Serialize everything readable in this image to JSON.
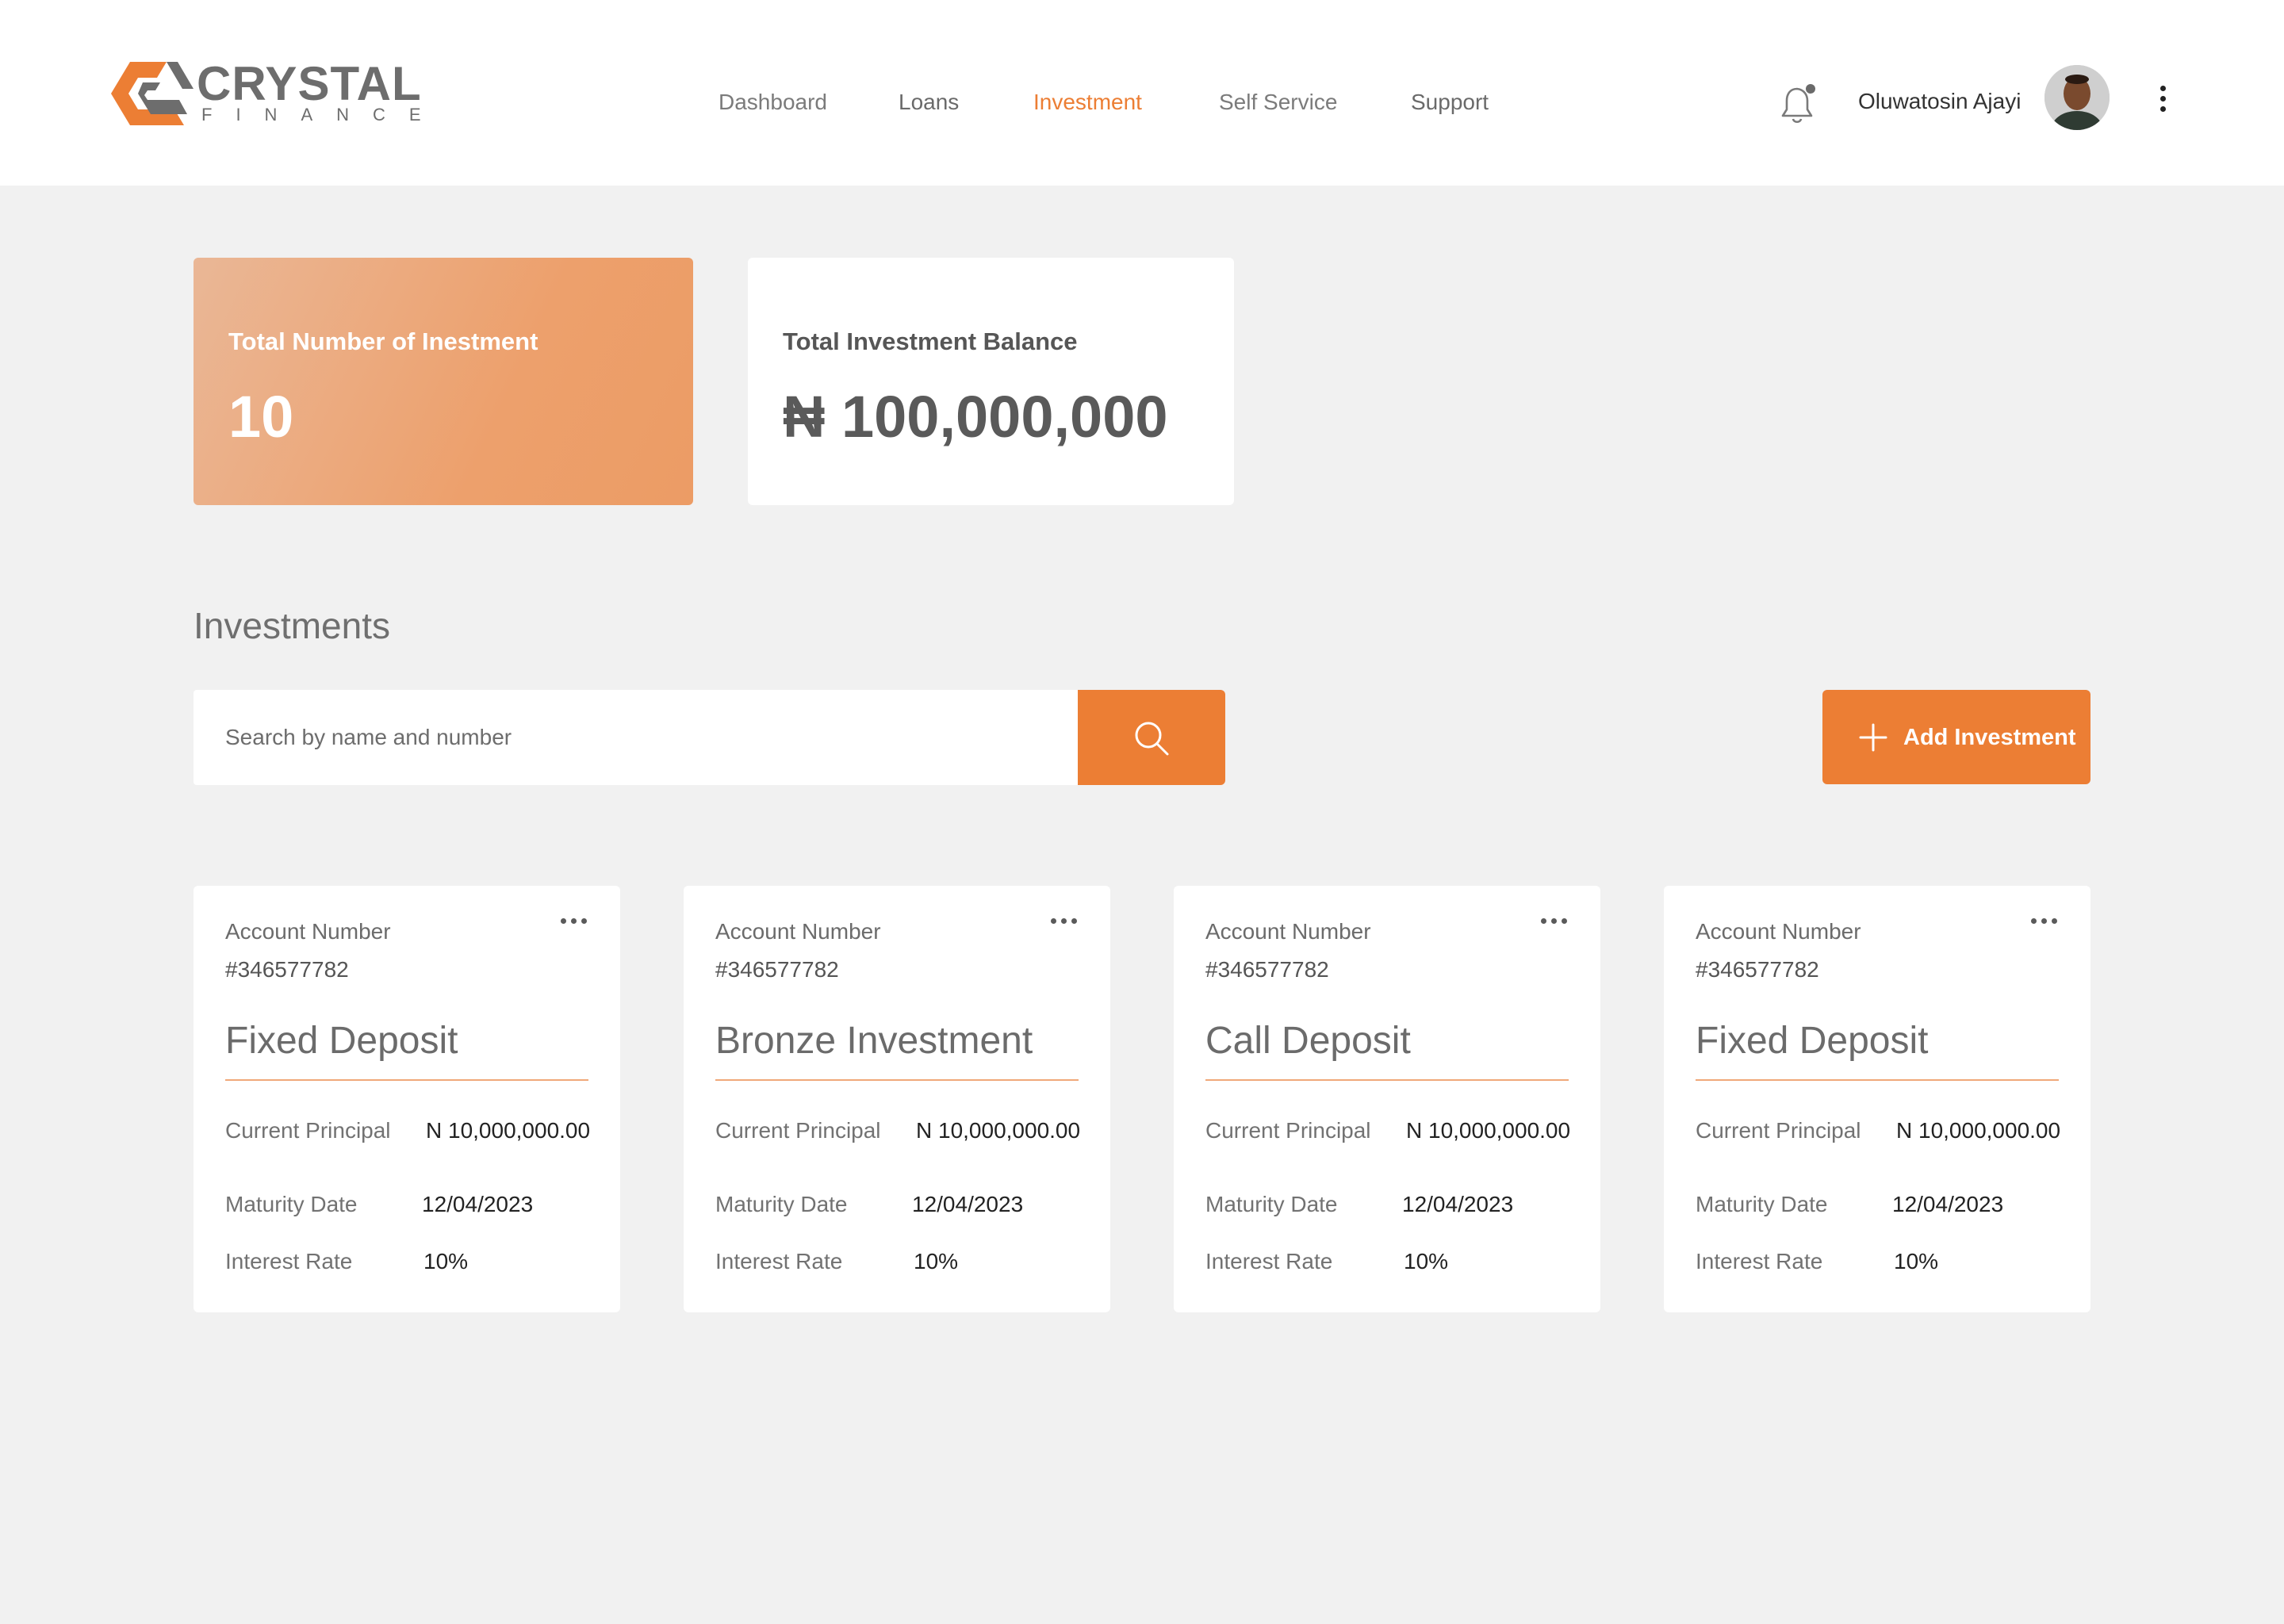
{
  "brand": {
    "name": "CRYSTAL",
    "tagline": "FINANCE",
    "accent_color": "#ec7e34"
  },
  "nav": [
    {
      "label": "Dashboard",
      "active": false
    },
    {
      "label": "Loans",
      "active": false
    },
    {
      "label": "Investment",
      "active": true
    },
    {
      "label": "Self Service",
      "active": false
    },
    {
      "label": "Support",
      "active": false
    }
  ],
  "header": {
    "notification_icon": "bell-icon",
    "user_name": "Oluwatosin Ajayi",
    "menu_icon": "kebab-vertical-icon"
  },
  "summary": {
    "total_count_label": "Total Number of Inestment",
    "total_count_value": "10",
    "balance_label": "Total Investment Balance",
    "balance_value": "₦ 100,000,000"
  },
  "investments_section": {
    "title": "Investments",
    "search_placeholder": "Search by name and number",
    "search_icon": "search-icon",
    "add_button_label": "Add Investment",
    "add_icon": "plus-icon"
  },
  "cards": [
    {
      "account_label": "Account Number",
      "account_number": "#346577782",
      "type": "Fixed Deposit",
      "principal_label": "Current Principal",
      "principal_value": "N 10,000,000.00",
      "maturity_label": "Maturity Date",
      "maturity_value": "12/04/2023",
      "rate_label": "Interest Rate",
      "rate_value": "10%"
    },
    {
      "account_label": "Account Number",
      "account_number": "#346577782",
      "type": "Bronze Investment",
      "principal_label": "Current Principal",
      "principal_value": "N 10,000,000.00",
      "maturity_label": "Maturity Date",
      "maturity_value": "12/04/2023",
      "rate_label": "Interest Rate",
      "rate_value": "10%"
    },
    {
      "account_label": "Account Number",
      "account_number": "#346577782",
      "type": "Call Deposit",
      "principal_label": "Current Principal",
      "principal_value": "N 10,000,000.00",
      "maturity_label": "Maturity Date",
      "maturity_value": "12/04/2023",
      "rate_label": "Interest Rate",
      "rate_value": "10%"
    },
    {
      "account_label": "Account Number",
      "account_number": "#346577782",
      "type": "Fixed Deposit",
      "principal_label": "Current Principal",
      "principal_value": "N 10,000,000.00",
      "maturity_label": "Maturity Date",
      "maturity_value": "12/04/2023",
      "rate_label": "Interest Rate",
      "rate_value": "10%"
    }
  ]
}
